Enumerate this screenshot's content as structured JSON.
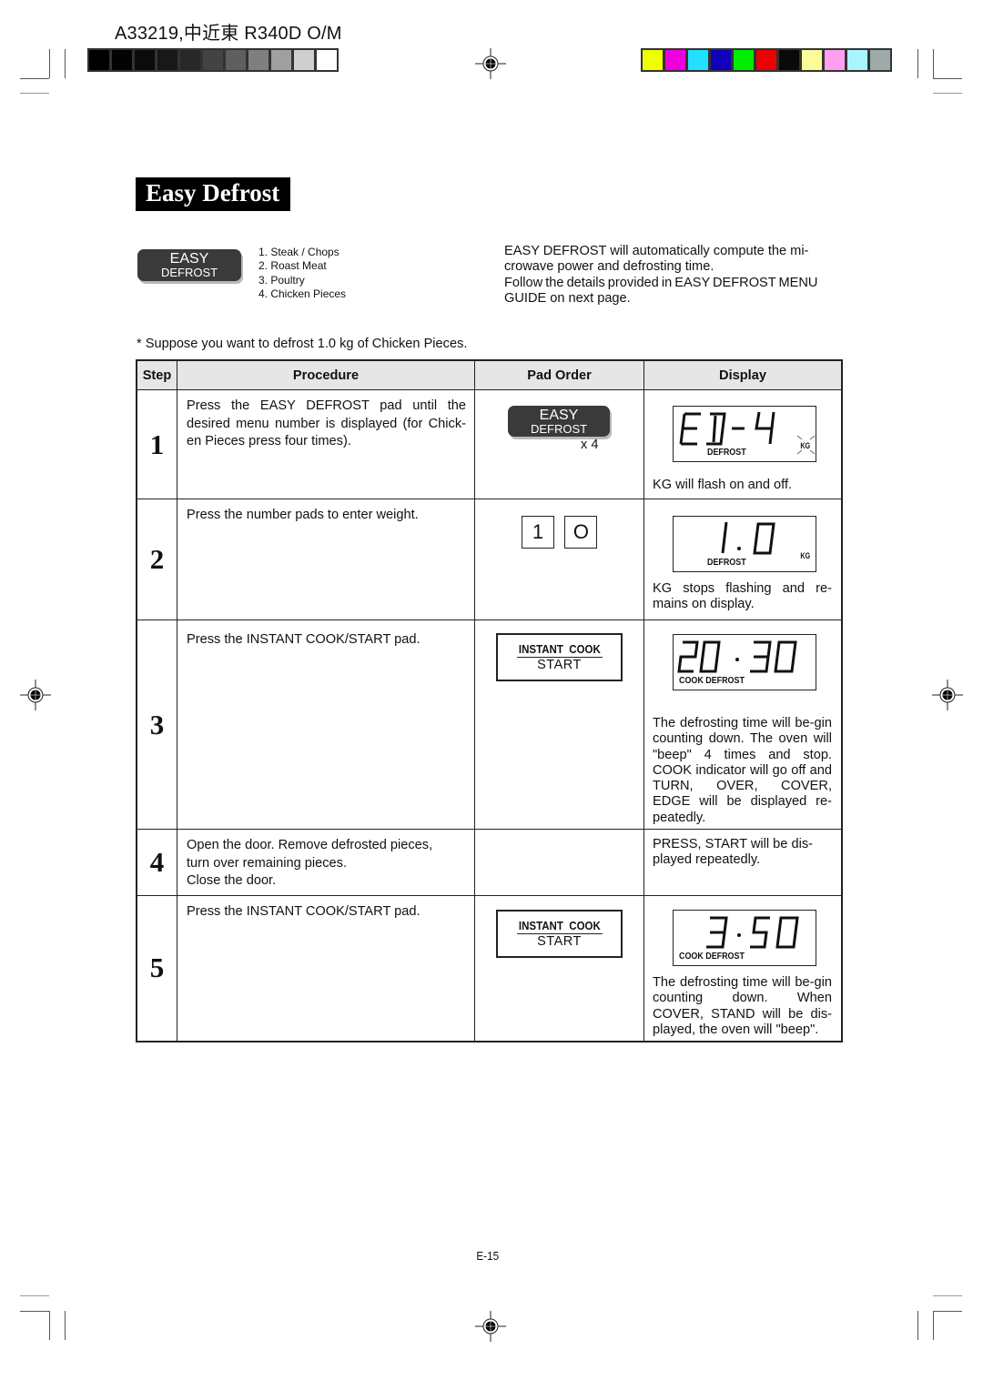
{
  "header": {
    "doc_id": "A33219,中近東 R340D O/M"
  },
  "calibration": {
    "gray_swatches": [
      "#000000",
      "#030303",
      "#0b0b0b",
      "#181818",
      "#282828",
      "#434343",
      "#5f5f5f",
      "#7f7f7f",
      "#a0a0a0",
      "#cfcfcf",
      "#ffffff"
    ],
    "color_swatches": [
      "#eeff00",
      "#ee00dd",
      "#22e0ff",
      "#1100bb",
      "#00ee00",
      "#ee0000",
      "#0a0a0a",
      "#fbfb99",
      "#ff9ff0",
      "#aaf4ff",
      "#9eaaaa"
    ]
  },
  "title": "Easy Defrost",
  "easy_pad": {
    "line1": "EASY",
    "line2": "DEFROST"
  },
  "menu": {
    "items": [
      "1. Steak / Chops",
      "2. Roast Meat",
      "3. Poultry",
      "4. Chicken Pieces"
    ]
  },
  "intro": {
    "line1": "EASY DEFROST will automatically compute the mi-",
    "line2": "crowave power and defrosting time.",
    "line3": "Follow the details provided in EASY DEFROST MENU",
    "line4": "GUIDE on next page."
  },
  "suppose": "* Suppose you want to defrost 1.0 kg of Chicken Pieces.",
  "table": {
    "headers": {
      "step": "Step",
      "procedure": "Procedure",
      "pad_order": "Pad Order",
      "display": "Display"
    },
    "rows": [
      {
        "step": "1",
        "procedure": "Press the EASY DEFROST pad until the desired menu number is displayed (for Chick-en Pieces press four times).",
        "pad": {
          "type": "easy",
          "line1": "EASY",
          "line2": "DEFROST",
          "multiplier": "x 4"
        },
        "display": {
          "readout": "ED-4",
          "indicators": "DEFROST",
          "unit": "KG",
          "unit_flashing": true
        },
        "note": "KG will flash on and off."
      },
      {
        "step": "2",
        "procedure": "Press the number pads to enter weight.",
        "pad": {
          "type": "number",
          "keys": [
            "1",
            "O"
          ]
        },
        "display": {
          "readout": "1.0",
          "indicators": "DEFROST",
          "unit": "KG",
          "unit_flashing": false
        },
        "note": "KG stops flashing and re-mains on display."
      },
      {
        "step": "3",
        "procedure": "Press the INSTANT COOK/START pad.",
        "pad": {
          "type": "instant",
          "line1": "INSTANT  COOK",
          "line2": "START"
        },
        "display": {
          "readout": "20.30",
          "indicators": "COOK DEFROST"
        },
        "note": "The defrosting time will be-gin counting down. The oven will \"beep\" 4 times and stop. COOK indicator will go off and TURN, OVER, COVER, EDGE will be displayed re-peatedly."
      },
      {
        "step": "4",
        "procedure_lines": [
          "Open the door. Remove defrosted pieces,",
          "turn over remaining pieces.",
          "Close the door."
        ],
        "note": "PRESS, START will be dis-played repeatedly."
      },
      {
        "step": "5",
        "procedure": "Press the INSTANT COOK/START pad.",
        "pad": {
          "type": "instant",
          "line1": "INSTANT  COOK",
          "line2": "START"
        },
        "display": {
          "readout": "3.50",
          "indicators": "COOK DEFROST"
        },
        "note": "The defrosting time will be-gin counting down. When COVER, STAND will be dis-played, the oven will \"beep\"."
      }
    ]
  },
  "page_number": "E-15"
}
